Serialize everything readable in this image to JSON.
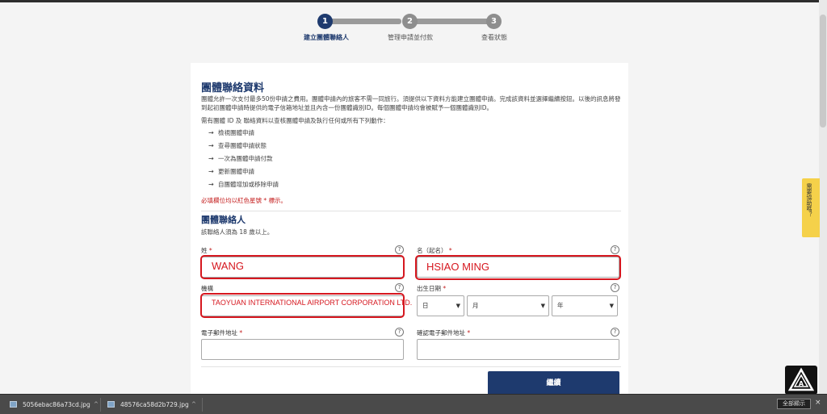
{
  "stepper": {
    "steps": [
      {
        "num": "1",
        "label": "建立團體聯絡人"
      },
      {
        "num": "2",
        "label": "管理申請並付款"
      },
      {
        "num": "3",
        "label": "查看狀態"
      }
    ]
  },
  "section": {
    "title": "團體聯絡資料",
    "intro": "團體允許一次支付最多50份申請之費用。團體申請內的旅客不需一同旅行。須提供以下資料方能建立團體申請。完成該資料並選擇繼續按鈕。以後的訊息將發到起初團體申請時提供的電子信箱地址並且內含一份團體識別ID。每個團體申請均會被賦予一個團體識別ID。",
    "need_text": "需有團體 ID 及 聯絡資料以查核團體申請及執行任何或所有下列動作：",
    "actions": [
      "檢視團體申請",
      "查尋團體申請狀態",
      "一次為團體申請付款",
      "更新團體申請",
      "自團體增加或移除申請"
    ],
    "required_note": "必填欄位均以紅色星號 * 標示。"
  },
  "contact": {
    "title": "團體聯絡人",
    "age_note": "該聯絡人須為 18 歲以上。",
    "surname_label": "姓",
    "given_label": "名（起名）",
    "org_label": "機構",
    "dob_label": "出生日期",
    "email_label": "電子郵件地址",
    "email_confirm_label": "確認電子郵件地址",
    "surname_value": "WANG",
    "given_value": "HSIAO MING",
    "org_value": "TAOYUAN INTERNATIONAL AIRPORT CORPORATION LTD.",
    "dob_day": "日",
    "dob_month": "月",
    "dob_year": "年",
    "star": "*",
    "help": "?"
  },
  "buttons": {
    "continue": "繼續"
  },
  "feedback": {
    "label": "需要協助嗎？"
  },
  "downloads": {
    "files": [
      "5056ebac86a73cd.jpg",
      "48576ca58d2b729.jpg"
    ],
    "show_all": "全部顯示",
    "close": "×"
  },
  "colors": {
    "brand": "#1e3a6e",
    "highlight": "#d6171f",
    "feedback": "#f5d14a"
  }
}
